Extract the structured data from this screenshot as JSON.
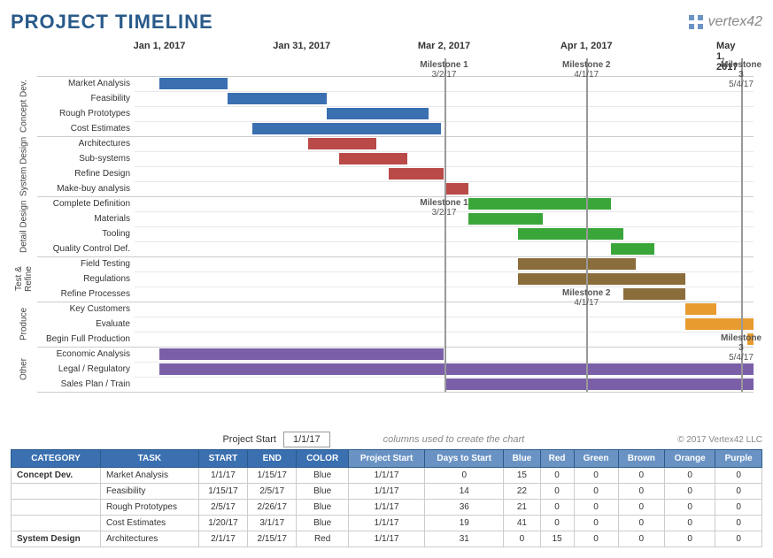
{
  "title": "PROJECT TIMELINE",
  "logo": "vertex42",
  "copyright": "© 2017 Vertex42 LLC",
  "project_start_label": "Project Start",
  "project_start_value": "1/1/17",
  "columns_note": "columns used to create the chart",
  "chart_data": {
    "type": "gantt",
    "x_axis_dates": [
      "Jan 1, 2017",
      "Jan 31, 2017",
      "Mar 2, 2017",
      "Apr 1, 2017",
      "May 1, 2017"
    ],
    "x_axis_positions_pct": [
      4,
      27,
      50,
      73,
      96
    ],
    "milestones": [
      {
        "name": "Milestone 1",
        "date": "3/2/17",
        "pos_pct": 50,
        "label_top_row": 2,
        "label_bottom_row": 10
      },
      {
        "name": "Milestone 2",
        "date": "4/1/17",
        "pos_pct": 73,
        "label_top_row": 2,
        "label_bottom_row": 16
      },
      {
        "name": "Milestone 3",
        "date": "5/4/17",
        "pos_pct": 98,
        "label_top_row": 2,
        "label_bottom_row": 19
      }
    ],
    "groups": [
      {
        "name": "Concept Dev.",
        "short": "Concept\nDev.",
        "tasks": [
          {
            "name": "Market Analysis",
            "start_pct": 4,
            "len_pct": 11,
            "color": "blue"
          },
          {
            "name": "Feasibility",
            "start_pct": 15,
            "len_pct": 16,
            "color": "blue"
          },
          {
            "name": "Rough Prototypes",
            "start_pct": 31,
            "len_pct": 16.5,
            "color": "blue"
          },
          {
            "name": "Cost Estimates",
            "start_pct": 19,
            "len_pct": 30.5,
            "color": "blue"
          }
        ]
      },
      {
        "name": "System Design",
        "short": "System\nDesign",
        "tasks": [
          {
            "name": "Architectures",
            "start_pct": 28,
            "len_pct": 11,
            "color": "red"
          },
          {
            "name": "Sub-systems",
            "start_pct": 33,
            "len_pct": 11,
            "color": "red"
          },
          {
            "name": "Refine Design",
            "start_pct": 41,
            "len_pct": 9,
            "color": "red"
          },
          {
            "name": "Make-buy analysis",
            "start_pct": 50,
            "len_pct": 4,
            "color": "red"
          }
        ]
      },
      {
        "name": "Detail Design",
        "short": "Detail\nDesign",
        "tasks": [
          {
            "name": "Complete Definition",
            "start_pct": 54,
            "len_pct": 23,
            "color": "green"
          },
          {
            "name": "Materials",
            "start_pct": 54,
            "len_pct": 12,
            "color": "green"
          },
          {
            "name": "Tooling",
            "start_pct": 62,
            "len_pct": 17,
            "color": "green"
          },
          {
            "name": "Quality Control Def.",
            "start_pct": 77,
            "len_pct": 7,
            "color": "green"
          }
        ]
      },
      {
        "name": "Test & Refine",
        "short": "Test &\nRefine",
        "tasks": [
          {
            "name": "Field Testing",
            "start_pct": 62,
            "len_pct": 19,
            "color": "brown"
          },
          {
            "name": "Regulations",
            "start_pct": 62,
            "len_pct": 27,
            "color": "brown"
          },
          {
            "name": "Refine Processes",
            "start_pct": 79,
            "len_pct": 10,
            "color": "brown"
          }
        ]
      },
      {
        "name": "Produce",
        "short": "Produce",
        "tasks": [
          {
            "name": "Key Customers",
            "start_pct": 89,
            "len_pct": 5,
            "color": "orange"
          },
          {
            "name": "Evaluate",
            "start_pct": 89,
            "len_pct": 11,
            "color": "orange"
          },
          {
            "name": "Begin Full Production",
            "start_pct": 99,
            "len_pct": 1,
            "color": "orange"
          }
        ]
      },
      {
        "name": "Other",
        "short": "Other",
        "tasks": [
          {
            "name": "Economic Analysis",
            "start_pct": 4,
            "len_pct": 46,
            "color": "purple"
          },
          {
            "name": "Legal / Regulatory",
            "start_pct": 4,
            "len_pct": 96,
            "color": "purple"
          },
          {
            "name": "Sales Plan / Train",
            "start_pct": 50,
            "len_pct": 50,
            "color": "purple"
          }
        ]
      }
    ]
  },
  "table": {
    "headers_main": [
      "CATEGORY",
      "TASK",
      "START",
      "END",
      "COLOR"
    ],
    "headers_calc": [
      "Project Start",
      "Days to Start",
      "Blue",
      "Red",
      "Green",
      "Brown",
      "Orange",
      "Purple"
    ],
    "rows": [
      {
        "cat": "Concept Dev.",
        "task": "Market Analysis",
        "start": "1/1/17",
        "end": "1/15/17",
        "color": "Blue",
        "ps": "1/1/17",
        "dts": 0,
        "vals": [
          15,
          0,
          0,
          0,
          0,
          0
        ]
      },
      {
        "cat": "",
        "task": "Feasibility",
        "start": "1/15/17",
        "end": "2/5/17",
        "color": "Blue",
        "ps": "1/1/17",
        "dts": 14,
        "vals": [
          22,
          0,
          0,
          0,
          0,
          0
        ]
      },
      {
        "cat": "",
        "task": "Rough Prototypes",
        "start": "2/5/17",
        "end": "2/26/17",
        "color": "Blue",
        "ps": "1/1/17",
        "dts": 36,
        "vals": [
          21,
          0,
          0,
          0,
          0,
          0
        ]
      },
      {
        "cat": "",
        "task": "Cost Estimates",
        "start": "1/20/17",
        "end": "3/1/17",
        "color": "Blue",
        "ps": "1/1/17",
        "dts": 19,
        "vals": [
          41,
          0,
          0,
          0,
          0,
          0
        ]
      },
      {
        "cat": "System Design",
        "task": "Architectures",
        "start": "2/1/17",
        "end": "2/15/17",
        "color": "Red",
        "ps": "1/1/17",
        "dts": 31,
        "vals": [
          0,
          15,
          0,
          0,
          0,
          0
        ]
      }
    ]
  }
}
